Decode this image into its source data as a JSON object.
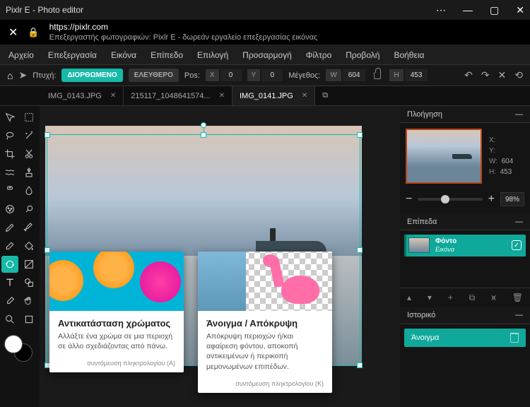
{
  "window": {
    "title": "Pixlr E - Photo editor"
  },
  "url": {
    "domain": "https://pixlr.com",
    "description": "Επεξεργαστής φωτογραφιών: Pixlr E - δωρεάν εργαλείο επεξεργασίας εικόνας"
  },
  "menu": [
    "Αρχείο",
    "Επεξεργασία",
    "Εικόνα",
    "Επίπεδο",
    "Επιλογή",
    "Προσαρμογή",
    "Φίλτρο",
    "Προβολή",
    "Βοήθεια"
  ],
  "options": {
    "fold_label": "Πτυχή:",
    "fold_fixed": "ΔΙΟΡΘΩΜΕΝΟ",
    "fold_free": "ΕΛΕΥΘΕΡΟ",
    "pos_label": "Pos:",
    "x": "0",
    "y": "0",
    "size_label": "Μέγεθος:",
    "w": "604",
    "h": "453"
  },
  "tabs": [
    {
      "name": "IMG_0143.JPG",
      "active": false
    },
    {
      "name": "215117_1048641574...",
      "active": false
    },
    {
      "name": "IMG_0141.JPG",
      "active": true
    }
  ],
  "tooltips": {
    "left": {
      "title": "Αντικατάσταση χρώματος",
      "desc": "Αλλάξτε ένα χρώμα σε μια περιοχή σε άλλο σχεδιάζοντας από πάνω.",
      "shortcut": "συντόμευση πληκτρολογίου (A)"
    },
    "right": {
      "title": "Άνοιγμα / Απόκρυψη",
      "desc": "Απόκρυψη περιοχών ή/και αφαίρεση φόντου, αποκοπή αντικειμένων ή περικοπή μεμονωμένων επιπέδων.",
      "shortcut": "συντόμευση πληκτρολογίου (K)"
    }
  },
  "panels": {
    "nav": {
      "title": "Πλοήγηση",
      "x_label": "X:",
      "y_label": "Y:",
      "w_label": "W:",
      "h_label": "H:",
      "w": "604",
      "h": "453",
      "zoom": "98%"
    },
    "layers": {
      "title": "Επίπεδα",
      "item": {
        "name": "Φόντο",
        "type": "Εικόνα"
      }
    },
    "history": {
      "title": "Ιστορικό",
      "item": "Άνοιγμα"
    }
  }
}
